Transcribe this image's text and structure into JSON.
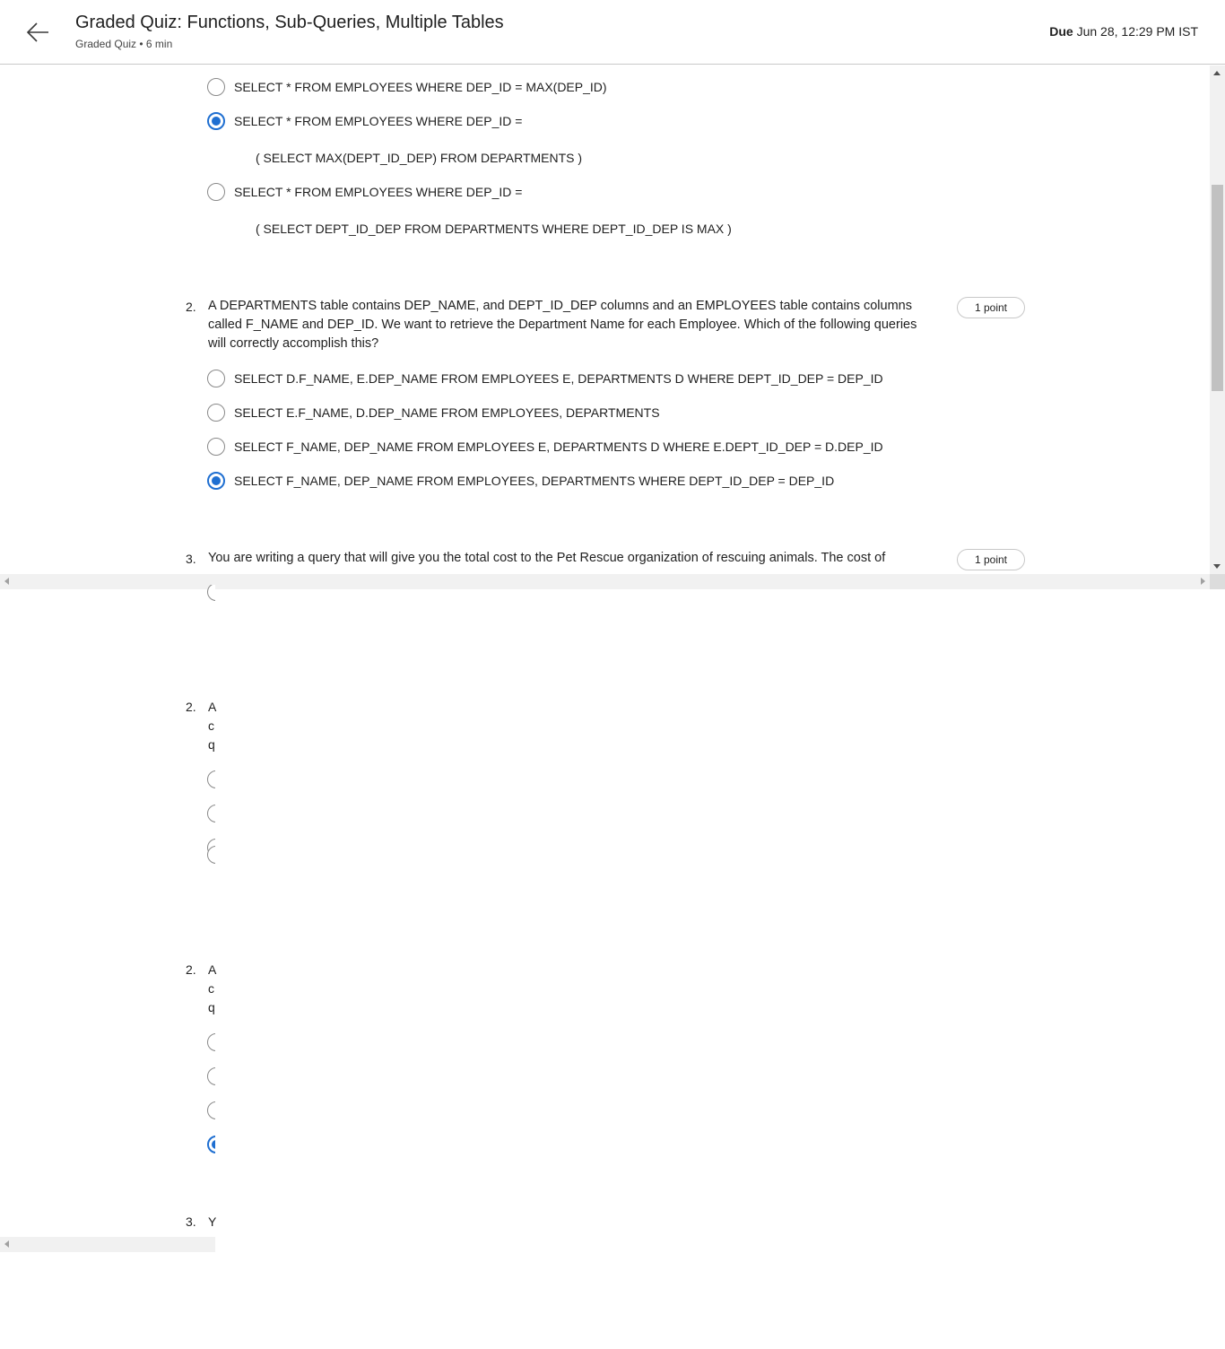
{
  "header": {
    "title": "Graded Quiz: Functions, Sub-Queries, Multiple Tables",
    "subtitle": "Graded Quiz • 6 min",
    "due_label": "Due",
    "due_value": "Jun 28, 12:29 PM IST"
  },
  "question1": {
    "options": [
      {
        "text": "SELECT * FROM EMPLOYEES WHERE DEP_ID = MAX(DEP_ID)",
        "selected": false
      },
      {
        "text": "SELECT * FROM EMPLOYEES WHERE DEP_ID =",
        "continuation": "( SELECT MAX(DEPT_ID_DEP) FROM DEPARTMENTS )",
        "selected": true
      },
      {
        "text": "SELECT * FROM EMPLOYEES WHERE DEP_ID =",
        "continuation": "( SELECT DEPT_ID_DEP FROM DEPARTMENTS WHERE DEPT_ID_DEP IS MAX )",
        "selected": false
      }
    ]
  },
  "question2": {
    "number": "2.",
    "text": "A DEPARTMENTS table contains DEP_NAME, and DEPT_ID_DEP columns and an EMPLOYEES table contains columns called F_NAME and DEP_ID. We want to retrieve the Department Name for each Employee. Which of the following queries will correctly accomplish this?",
    "points": "1 point",
    "options": [
      {
        "text": "SELECT D.F_NAME, E.DEP_NAME FROM EMPLOYEES E, DEPARTMENTS D WHERE DEPT_ID_DEP = DEP_ID",
        "selected": false
      },
      {
        "text": "SELECT E.F_NAME, D.DEP_NAME FROM EMPLOYEES, DEPARTMENTS",
        "selected": false
      },
      {
        "text": "SELECT F_NAME, DEP_NAME FROM EMPLOYEES E, DEPARTMENTS D WHERE E.DEPT_ID_DEP = D.DEP_ID",
        "selected": false
      },
      {
        "text": "SELECT F_NAME, DEP_NAME FROM EMPLOYEES, DEPARTMENTS WHERE DEPT_ID_DEP = DEP_ID",
        "selected": true
      }
    ]
  },
  "question3": {
    "number": "3.",
    "text": "You are writing a query that will give you the total cost to the Pet Rescue organization of rescuing animals. The cost of",
    "points": "1 point"
  },
  "ghost": {
    "block_a": {
      "number": "2.",
      "lines": [
        "A",
        "c",
        "q"
      ]
    },
    "block_b": {
      "number": "2.",
      "lines": [
        "A",
        "c",
        "q"
      ]
    },
    "block_c": {
      "number": "3.",
      "lines": [
        "Y"
      ]
    }
  }
}
